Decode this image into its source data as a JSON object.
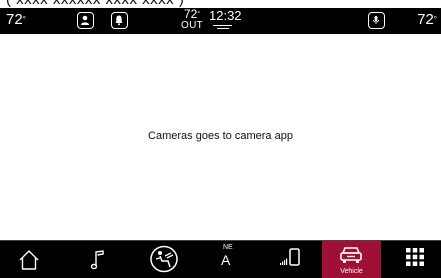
{
  "caption": "( xxxx xxxxxx xxxx xxxx )",
  "status_bar": {
    "temp_left": "72",
    "temp_right": "72",
    "degree_symbol": "°",
    "outside_temp": "72",
    "outside_label": "OUT",
    "time": "12:32",
    "icons": [
      "profile-icon",
      "notification-bell-icon",
      "microphone-icon"
    ]
  },
  "main": {
    "message": "Cameras goes to camera app"
  },
  "bottom_nav": {
    "items": [
      {
        "id": "home",
        "icon": "home-icon"
      },
      {
        "id": "media",
        "icon": "music-note-icon"
      },
      {
        "id": "climate",
        "icon": "climate-fan-icon"
      },
      {
        "id": "nav",
        "icon": "compass-icon",
        "direction": "NE",
        "letter": "A"
      },
      {
        "id": "phone",
        "icon": "phone-signal-icon"
      },
      {
        "id": "vehicle",
        "icon": "vehicle-car-icon",
        "label": "Vehicle",
        "active": true
      },
      {
        "id": "apps",
        "icon": "apps-grid-icon"
      }
    ]
  },
  "colors": {
    "bar_background": "#000000",
    "active_tab": "#a00f34",
    "content_background": "#ffffff"
  }
}
